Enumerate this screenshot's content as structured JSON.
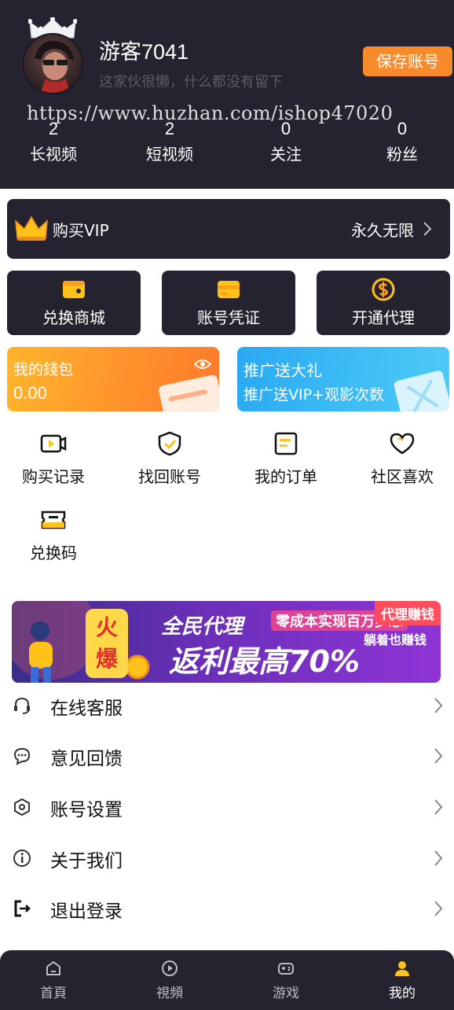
{
  "profile": {
    "username": "游客7041",
    "bio": "这家伙很懒，什么都没有留下",
    "save_button": "保存账号",
    "watermark": "https://www.huzhan.com/ishop47020"
  },
  "stats": [
    {
      "value": "2",
      "label": "长视频"
    },
    {
      "value": "2",
      "label": "短视频"
    },
    {
      "value": "0",
      "label": "关注"
    },
    {
      "value": "0",
      "label": "粉丝"
    }
  ],
  "vip": {
    "title": "购买VIP",
    "status": "永久无限"
  },
  "quick_actions": [
    {
      "label": "兑换商城",
      "icon": "shop-card-icon"
    },
    {
      "label": "账号凭证",
      "icon": "credential-card-icon"
    },
    {
      "label": "开通代理",
      "icon": "dollar-coin-icon"
    }
  ],
  "wallet": {
    "title": "我的錢包",
    "amount": "0.00"
  },
  "promo": {
    "title": "推广送大礼",
    "subtitle": "推广送VIP+观影次数"
  },
  "grid": [
    {
      "label": "购买记录",
      "icon": "purchase-record-icon"
    },
    {
      "label": "找回账号",
      "icon": "shield-check-icon"
    },
    {
      "label": "我的订单",
      "icon": "order-list-icon"
    },
    {
      "label": "社区喜欢",
      "icon": "heart-icon"
    },
    {
      "label": "兑换码",
      "icon": "ticket-icon"
    }
  ],
  "banner": {
    "tag": "代理赚钱",
    "fire": "火爆",
    "line1": "全民代理",
    "line2": "返利最高70%",
    "line3": "零成本实现百万梦想",
    "line4": "躺着也赚钱"
  },
  "menu": [
    {
      "label": "在线客服",
      "icon": "headset-icon"
    },
    {
      "label": "意见回馈",
      "icon": "chat-bubble-icon"
    },
    {
      "label": "账号设置",
      "icon": "hexagon-settings-icon"
    },
    {
      "label": "关于我们",
      "icon": "info-icon"
    },
    {
      "label": "退出登录",
      "icon": "logout-icon"
    }
  ],
  "tabs": [
    {
      "label": "首頁",
      "icon": "home-icon",
      "active": false
    },
    {
      "label": "視頻",
      "icon": "play-icon",
      "active": false
    },
    {
      "label": "游戏",
      "icon": "gamepad-icon",
      "active": false
    },
    {
      "label": "我的",
      "icon": "user-icon",
      "active": true
    }
  ],
  "colors": {
    "header_bg": "#25232f",
    "accent_orange": "#f78a2b",
    "icon_yellow": "#ffc21a"
  }
}
